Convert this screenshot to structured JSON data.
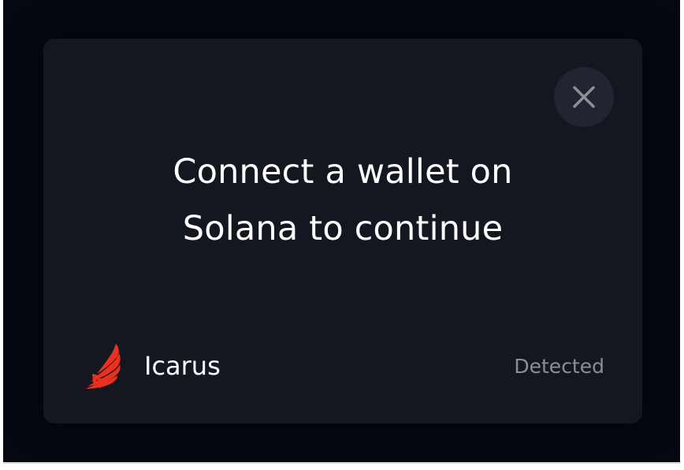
{
  "modal": {
    "title_line1": "Connect a wallet on",
    "title_line2": "Solana to continue",
    "close_icon": "close-icon"
  },
  "wallets": [
    {
      "name": "Icarus",
      "status": "Detected",
      "icon": "wing-icon",
      "icon_color": "#e8321f"
    }
  ],
  "colors": {
    "backdrop": "#050711",
    "modal": "#141620",
    "close_button": "#22242f",
    "text_primary": "#ffffff",
    "text_secondary": "#8b8d96"
  }
}
